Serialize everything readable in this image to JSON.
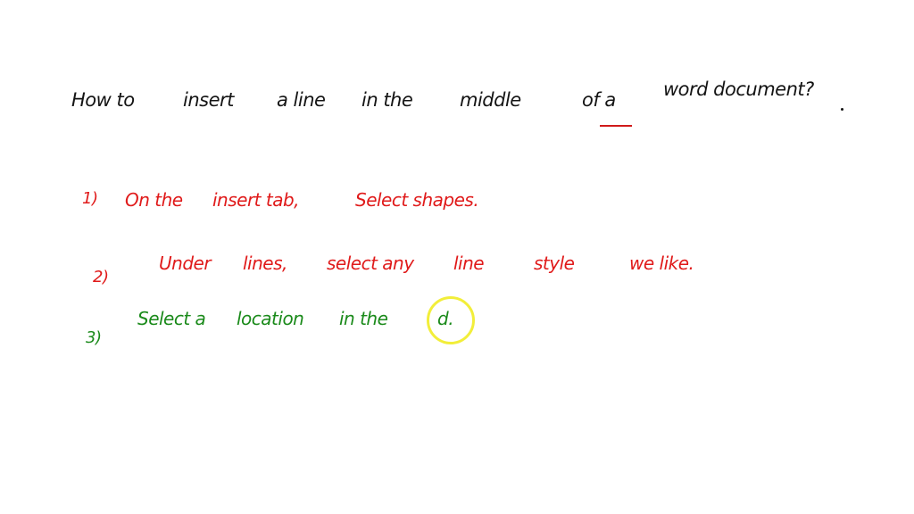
{
  "question": {
    "words": [
      "How to",
      "insert",
      "a line",
      "in the",
      "middle",
      "of a",
      "word document?"
    ]
  },
  "steps": [
    {
      "number": "1)",
      "color": "#e01a1a",
      "words": [
        "On the",
        "insert tab,",
        "Select shapes."
      ]
    },
    {
      "number": "2)",
      "color": "#e01a1a",
      "words": [
        "Under",
        "lines,",
        "select any",
        "line",
        "style",
        "we like."
      ]
    },
    {
      "number": "3)",
      "color": "#1a8a1a",
      "words": [
        "Select a",
        "location",
        "in the",
        "d."
      ]
    }
  ],
  "annotations": {
    "underline_color": "#d01a1a",
    "cursor_ring_color": "#f2ee3a"
  }
}
